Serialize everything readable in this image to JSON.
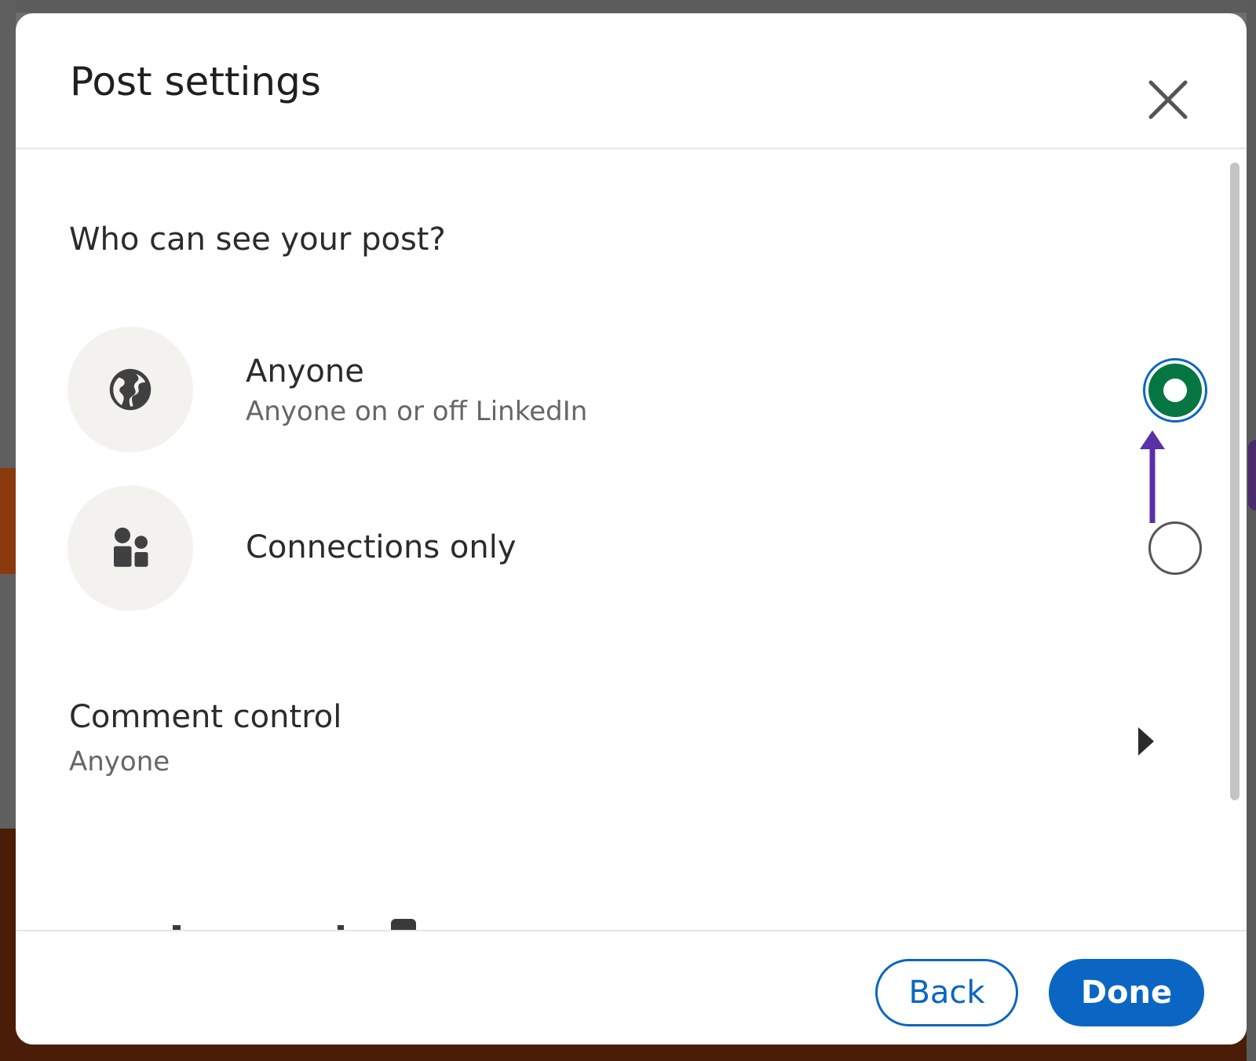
{
  "dialog": {
    "title": "Post settings",
    "close_icon": "close-icon"
  },
  "visibility": {
    "heading": "Who can see your post?",
    "options": [
      {
        "title": "Anyone",
        "subtitle": "Anyone on or off LinkedIn",
        "icon": "globe-icon",
        "selected": true
      },
      {
        "title": "Connections only",
        "subtitle": "",
        "icon": "people-icon",
        "selected": false
      }
    ]
  },
  "comment_control": {
    "title": "Comment control",
    "value": "Anyone",
    "icon": "chevron-right-icon"
  },
  "footer": {
    "back_label": "Back",
    "done_label": "Done"
  },
  "colors": {
    "primary_blue": "#0a66c2",
    "selected_green": "#057642",
    "annotation_purple": "#5b2fa8",
    "icon_bg": "#f3f2ef"
  }
}
